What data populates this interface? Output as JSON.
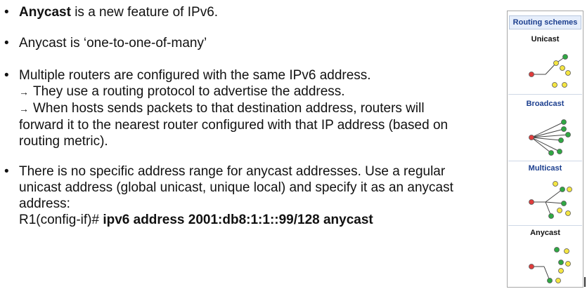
{
  "bullets": {
    "b1": {
      "bold": "Anycast",
      "rest": " is a new feature of IPv6."
    },
    "b2": {
      "text": "Anycast is ‘one-to-one-of-many’"
    },
    "b3": {
      "line1": "Multiple routers are configured with the same IPv6 address.",
      "arrow1": "They use a routing protocol to advertise the address.",
      "arrow2": "When hosts sends packets to that destination address, routers will forward it to the nearest router configured with that IP address (based on routing metric)."
    },
    "b4": {
      "text": "There is no specific address range for anycast addresses.  Use a regular unicast address (global unicast, unique local) and specify it as an anycast address:",
      "prompt": "R1(config-if)# ",
      "command": "ipv6 address 2001:db8:1:1::99/128 anycast"
    },
    "bullet_char": "•",
    "arrow_char": "→"
  },
  "panel": {
    "title": "Routing schemes",
    "schemes": [
      "Unicast",
      "Broadcast",
      "Multicast",
      "Anycast"
    ]
  },
  "colors": {
    "source": "#e03c3c",
    "green": "#2fa843",
    "yellow": "#f4e542",
    "title_text": "#1c3f8f"
  }
}
